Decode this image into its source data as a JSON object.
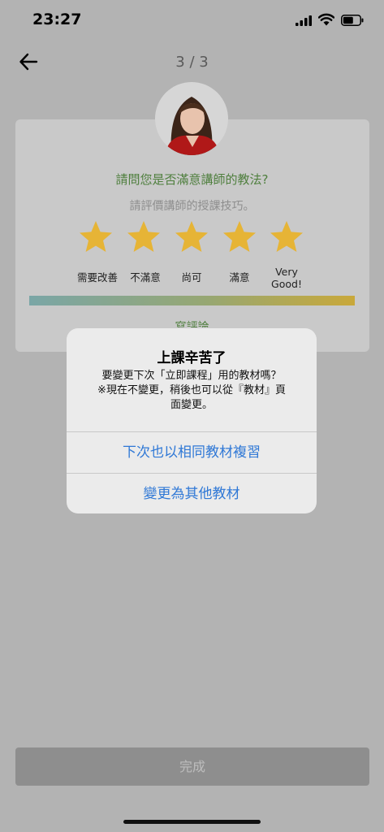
{
  "status_bar": {
    "time": "23:27"
  },
  "header": {
    "page_indicator": "3 / 3"
  },
  "rating": {
    "question": "請問您是否滿意講師的教法?",
    "subtitle": "請評價講師的授課技巧。",
    "star_color": "#e6b436",
    "labels": [
      "需要改善",
      "不滿意",
      "尚可",
      "滿意",
      "Very Good!"
    ],
    "write_review": "寫評論"
  },
  "dialog": {
    "title": "上課辛苦了",
    "message_lines": [
      "要變更下次「立即課程」用的教材嗎？",
      "※現在不變更，稍後也可以從『教材』頁",
      "面變更。"
    ],
    "primary_action": "下次也以相同教材複習",
    "secondary_action": "變更為其他教材",
    "action_color": "#2f78d6"
  },
  "footer": {
    "done_label": "完成"
  }
}
